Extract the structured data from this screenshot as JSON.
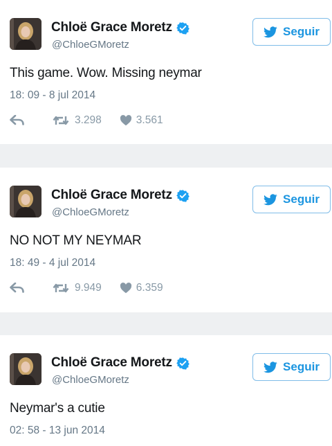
{
  "tweets": [
    {
      "name": "Chloë Grace Moretz",
      "handle": "@ChloeGMoretz",
      "follow_label": "Seguir",
      "text": "This game. Wow. Missing neymar",
      "time": "18: 09 - 8 jul 2014",
      "retweets": "3.298",
      "likes": "3.561"
    },
    {
      "name": "Chloë Grace Moretz",
      "handle": "@ChloeGMoretz",
      "follow_label": "Seguir",
      "text": "NO NOT MY NEYMAR",
      "time": "18: 49 - 4 jul 2014",
      "retweets": "9.949",
      "likes": "6.359"
    },
    {
      "name": "Chloë Grace Moretz",
      "handle": "@ChloeGMoretz",
      "follow_label": "Seguir",
      "text": "Neymar's a cutie",
      "time": "02: 58 - 13 jun 2014"
    }
  ],
  "colors": {
    "accent": "#1b95e0",
    "verified": "#1da1f2",
    "secondary_text": "#657786",
    "action_icons": "#8899a6"
  },
  "icons": {
    "verified": "verified-badge-icon",
    "follow": "twitter-bird-icon",
    "reply": "reply-icon",
    "retweet": "retweet-icon",
    "like": "heart-icon"
  }
}
